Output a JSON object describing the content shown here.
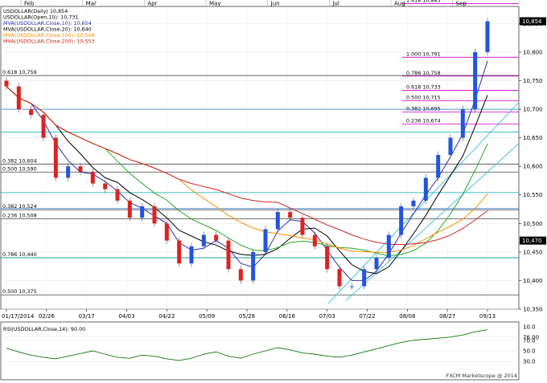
{
  "chart_data": {
    "type": "candlestick",
    "instrument": "USDOLLAR",
    "timeframe": "Daily",
    "legend": [
      {
        "text": "USDOLLAR(Daily) 10,854",
        "color": "#000000"
      },
      {
        "text": "USDOLLAR(Open,10): 10,731",
        "color": "#000000"
      },
      {
        "text": "MVA(USDOLLAR,Close,10): 10,654",
        "color": "#2e2eb8"
      },
      {
        "text": "MVA(USDOLLAR,Close,20): 10,640",
        "color": "#000000"
      },
      {
        "text": "MVA(USDOLLAR,Close,100): 10,508",
        "color": "#ff8c00"
      },
      {
        "text": "MVA(USDOLLAR,Close,200): 10,553",
        "color": "#cc2222"
      }
    ],
    "month_labels": [
      "Feb",
      "Mar",
      "Apr",
      "May",
      "Jun",
      "Jul",
      "Aug",
      "Sep"
    ],
    "x_tick_labels": [
      "01/17/2014",
      "02/26",
      "03/17",
      "04/03",
      "04/22",
      "05/09",
      "05/28",
      "06/16",
      "07/03",
      "07/22",
      "08/08",
      "08/27",
      "09/13"
    ],
    "y_axis": {
      "min": 10350,
      "max": 10880,
      "ticks": [
        "10,850",
        "10,800",
        "10,750",
        "10,700",
        "10,650",
        "10,600",
        "10,550",
        "10,500",
        "10,450",
        "10,400",
        "10,350"
      ]
    },
    "last_price_label": "10,854",
    "support_label": "10,470",
    "levels": [
      {
        "label": "1.618 10,885",
        "value": 10885,
        "color": "#cc00cc"
      },
      {
        "label": "0.618 10,759",
        "value": 10759,
        "color": "#000000"
      },
      {
        "label": "1.000 10,791",
        "value": 10791,
        "color": "#cc00cc"
      },
      {
        "label": "0.786 10,758",
        "value": 10758,
        "color": "#cc00cc"
      },
      {
        "label": "0.618 10,733",
        "value": 10733,
        "color": "#cc00cc"
      },
      {
        "label": "0.500 10,715",
        "value": 10715,
        "color": "#cc00cc"
      },
      {
        "label": "0.382 10,695",
        "value": 10695,
        "color": "#cc00cc"
      },
      {
        "label": "0.236 10,674",
        "value": 10674,
        "color": "#cc00cc"
      },
      {
        "label": "0.382 10,604",
        "value": 10604,
        "color": "#000000"
      },
      {
        "label": "0.500 10,590",
        "value": 10590,
        "color": "#000000"
      },
      {
        "label": "0.382 10,524",
        "value": 10524,
        "color": "#000000"
      },
      {
        "label": "0.236 10,508",
        "value": 10508,
        "color": "#000000"
      },
      {
        "label": "0.786 10,440",
        "value": 10440,
        "color": "#000000"
      },
      {
        "label": "0.500 10,375",
        "value": 10375,
        "color": "#000000"
      }
    ],
    "series": [
      {
        "name": "USDOLLAR",
        "style": "candles",
        "x": [
          "01/17",
          "01/23",
          "01/29",
          "02/04",
          "02/10",
          "02/16",
          "02/22",
          "02/28",
          "03/06",
          "03/12",
          "03/18",
          "03/24",
          "03/30",
          "04/05",
          "04/11",
          "04/17",
          "04/23",
          "04/29",
          "05/05",
          "05/11",
          "05/17",
          "05/23",
          "05/29",
          "06/04",
          "06/10",
          "06/16",
          "06/22",
          "06/28",
          "07/04",
          "07/10",
          "07/16",
          "07/22",
          "07/28",
          "08/03",
          "08/09",
          "08/15",
          "08/21",
          "08/27",
          "09/02",
          "09/05"
        ],
        "close": [
          10740,
          10700,
          10690,
          10650,
          10580,
          10600,
          10590,
          10570,
          10560,
          10540,
          10510,
          10530,
          10500,
          10470,
          10430,
          10460,
          10480,
          10470,
          10420,
          10400,
          10450,
          10490,
          10520,
          10510,
          10480,
          10460,
          10420,
          10390,
          10390,
          10420,
          10440,
          10480,
          10530,
          10540,
          10580,
          10620,
          10650,
          10700,
          10800,
          10854
        ]
      }
    ],
    "oscillator": {
      "label": "RSI(USDOLLAR,Close,14): 90.00",
      "values": [
        55,
        48,
        42,
        38,
        35,
        40,
        45,
        50,
        44,
        38,
        36,
        42,
        40,
        35,
        32,
        36,
        44,
        48,
        40,
        36,
        44,
        50,
        56,
        52,
        46,
        44,
        40,
        38,
        42,
        48,
        54,
        60,
        66,
        70,
        72,
        74,
        76,
        80,
        86,
        90
      ],
      "ticks": [
        "10.0",
        "76.00",
        "70.0",
        "50.0",
        "30.0"
      ]
    },
    "watermark": "FXCM Marketscope @ 2014",
    "grid": true
  }
}
